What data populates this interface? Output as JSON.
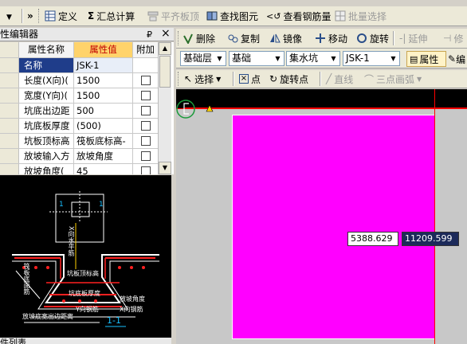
{
  "toolbar1": {
    "items": [
      {
        "label": "定义",
        "icon": "grid-table-icon"
      },
      {
        "label": "汇总计算",
        "icon": "sigma-icon"
      },
      {
        "label": "平齐板顶",
        "icon": "flat-top-icon",
        "disabled": true
      },
      {
        "label": "查找图元",
        "icon": "find-element-icon"
      },
      {
        "label": "查看钢筋量",
        "icon": "rebar-view-icon"
      },
      {
        "label": "批量选择",
        "icon": "batch-select-icon",
        "disabled": true
      }
    ]
  },
  "toolbar2": {
    "items": [
      {
        "label": "删除",
        "icon": "delete-icon"
      },
      {
        "label": "复制",
        "icon": "copy-icon"
      },
      {
        "label": "镜像",
        "icon": "mirror-icon"
      },
      {
        "label": "移动",
        "icon": "move-icon"
      },
      {
        "label": "旋转",
        "icon": "rotate-icon"
      },
      {
        "label": "延伸",
        "icon": "extend-icon",
        "disabled": true
      },
      {
        "label": "修",
        "icon": "trim-icon",
        "disabled": true
      }
    ]
  },
  "selectors": {
    "floor": "基础层",
    "category": "基础",
    "type": "集水坑",
    "component": "JSK-1",
    "property_button": "属性",
    "edit_button": "编"
  },
  "toolbar3": {
    "select": "选择",
    "point": "点",
    "rotate_point": "旋转点",
    "line": "直线",
    "arc": "三点画弧"
  },
  "panel": {
    "title": "性编辑器",
    "pin": "₽",
    "close": "×",
    "columns": [
      "属性名称",
      "属性值",
      "附加"
    ],
    "rows": [
      {
        "name": "名称",
        "value": "JSK-1",
        "has_checkbox": false,
        "selected": true
      },
      {
        "name": "长度(X向)(",
        "value": "1500",
        "has_checkbox": true
      },
      {
        "name": "宽度(Y向)(",
        "value": "1500",
        "has_checkbox": true
      },
      {
        "name": "坑底出边距",
        "value": "500",
        "has_checkbox": true
      },
      {
        "name": "坑底板厚度",
        "value": "(500)",
        "has_checkbox": true
      },
      {
        "name": "坑板顶标高",
        "value": "筏板底标高-",
        "has_checkbox": true
      },
      {
        "name": "放坡输入方",
        "value": "放坡角度",
        "has_checkbox": true
      },
      {
        "name": "放坡角度(",
        "value": "45",
        "has_checkbox": true
      }
    ]
  },
  "preview": {
    "label_1_top": "1",
    "label_1_right": "1",
    "label_pit_top": "坑板顶标高",
    "label_horizontal": "X向水平筋",
    "label_thickness": "坑底板厚度",
    "label_slope_angle": "放坡角度",
    "label_y_rebar": "Y向钢筋",
    "label_x_rebar": "X向钢筋",
    "label_bottom": "放坡底宽出边距离",
    "label_left": "筏板底面筋",
    "section": "1-1"
  },
  "canvas": {
    "coord_x": "5388.629",
    "coord_y": "11209.599",
    "colors": {
      "shape": "#ff00ff",
      "axis": "#ff0000",
      "background": "#c8c8c8"
    }
  },
  "bottom_label": "件列表"
}
